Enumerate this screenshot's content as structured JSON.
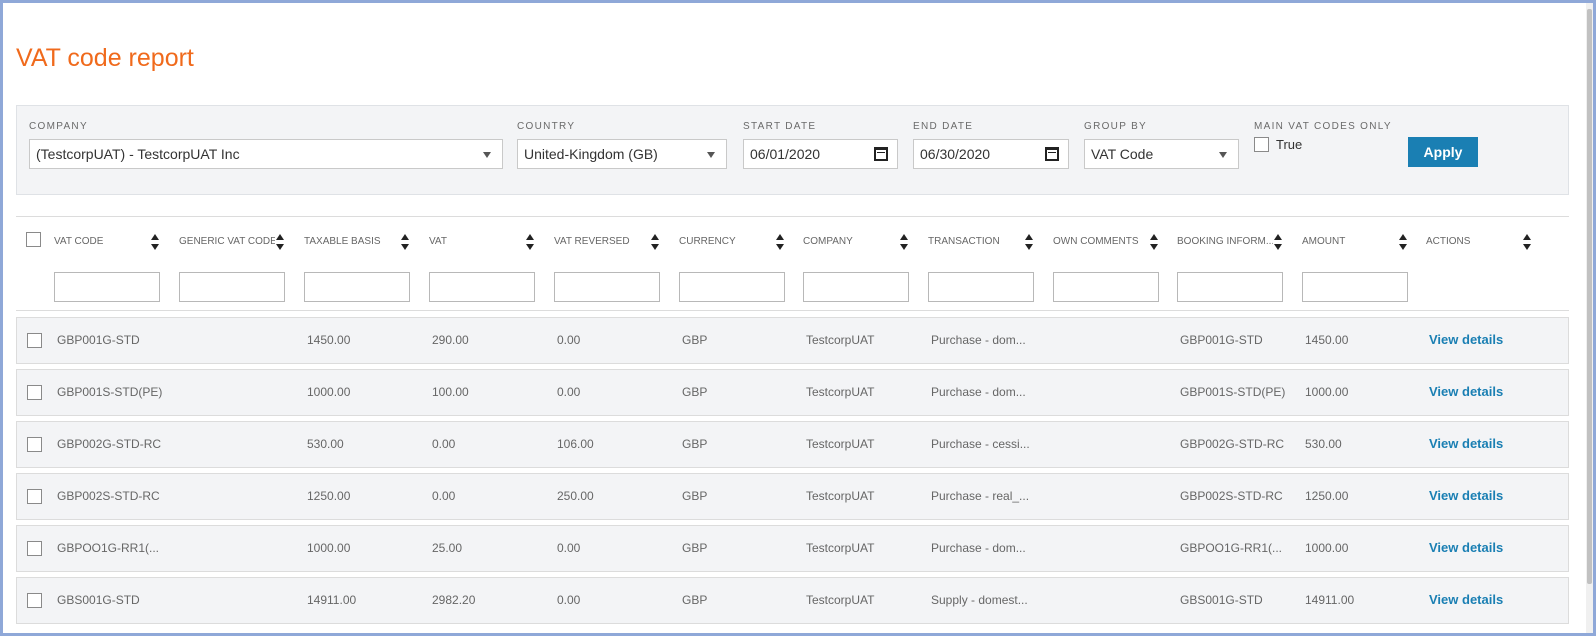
{
  "page": {
    "title": "VAT code report"
  },
  "filters": {
    "company": {
      "label": "COMPANY",
      "value": "(TestcorpUAT) - TestcorpUAT Inc"
    },
    "country": {
      "label": "COUNTRY",
      "value": "United-Kingdom (GB)"
    },
    "start_date": {
      "label": "START DATE",
      "value": "06/01/2020"
    },
    "end_date": {
      "label": "END DATE",
      "value": "06/30/2020"
    },
    "group_by": {
      "label": "GROUP BY",
      "value": "VAT Code"
    },
    "main_vat": {
      "label": "MAIN VAT CODES ONLY",
      "option": "True"
    },
    "apply_label": "Apply"
  },
  "columns": [
    "VAT CODE",
    "GENERIC VAT CODE",
    "TAXABLE BASIS",
    "VAT",
    "VAT REVERSED",
    "CURRENCY",
    "COMPANY",
    "TRANSACTION",
    "OWN COMMENTS",
    "BOOKING INFORM...",
    "AMOUNT",
    "ACTIONS"
  ],
  "rows": [
    {
      "vat_code": "GBP001G-STD",
      "generic": "",
      "taxable": "1450.00",
      "vat": "290.00",
      "reversed": "0.00",
      "currency": "GBP",
      "company": "TestcorpUAT",
      "transaction": "Purchase - dom...",
      "comments": "",
      "booking": "GBP001G-STD",
      "amount": "1450.00",
      "action": "View details"
    },
    {
      "vat_code": "GBP001S-STD(PE)",
      "generic": "",
      "taxable": "1000.00",
      "vat": "100.00",
      "reversed": "0.00",
      "currency": "GBP",
      "company": "TestcorpUAT",
      "transaction": "Purchase - dom...",
      "comments": "",
      "booking": "GBP001S-STD(PE)",
      "amount": "1000.00",
      "action": "View details"
    },
    {
      "vat_code": "GBP002G-STD-RC",
      "generic": "",
      "taxable": "530.00",
      "vat": "0.00",
      "reversed": "106.00",
      "currency": "GBP",
      "company": "TestcorpUAT",
      "transaction": "Purchase - cessi...",
      "comments": "",
      "booking": "GBP002G-STD-RC",
      "amount": "530.00",
      "action": "View details"
    },
    {
      "vat_code": "GBP002S-STD-RC",
      "generic": "",
      "taxable": "1250.00",
      "vat": "0.00",
      "reversed": "250.00",
      "currency": "GBP",
      "company": "TestcorpUAT",
      "transaction": "Purchase - real_...",
      "comments": "",
      "booking": "GBP002S-STD-RC",
      "amount": "1250.00",
      "action": "View details"
    },
    {
      "vat_code": "GBPOO1G-RR1(...",
      "generic": "",
      "taxable": "1000.00",
      "vat": "25.00",
      "reversed": "0.00",
      "currency": "GBP",
      "company": "TestcorpUAT",
      "transaction": "Purchase - dom...",
      "comments": "",
      "booking": "GBPOO1G-RR1(...",
      "amount": "1000.00",
      "action": "View details"
    },
    {
      "vat_code": "GBS001G-STD",
      "generic": "",
      "taxable": "14911.00",
      "vat": "2982.20",
      "reversed": "0.00",
      "currency": "GBP",
      "company": "TestcorpUAT",
      "transaction": "Supply - domest...",
      "comments": "",
      "booking": "GBS001G-STD",
      "amount": "14911.00",
      "action": "View details"
    }
  ]
}
